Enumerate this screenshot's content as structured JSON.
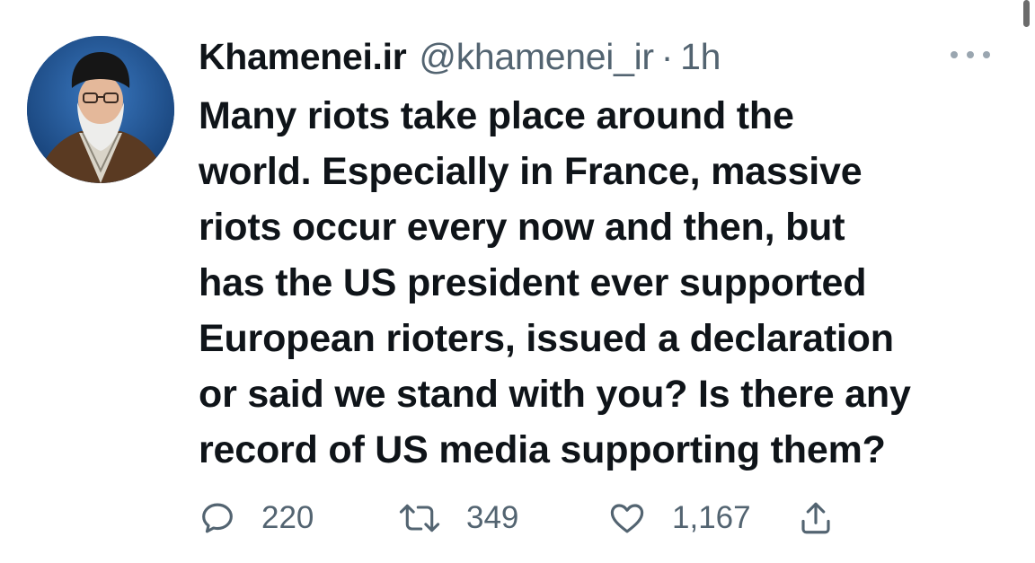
{
  "tweet": {
    "display_name": "Khamenei.ir",
    "handle": "@khamenei_ir",
    "separator": "·",
    "time": "1h",
    "text_lines": [
      "Many riots take place around the",
      "world. Especially in France, massive",
      "riots occur every now and then, but",
      "has the US president ever supported",
      "European rioters, issued a declaration",
      "or said we stand with you? Is there any",
      "record of US media supporting them?"
    ]
  },
  "actions": {
    "reply_count": "220",
    "retweet_count": "349",
    "like_count": "1,167"
  },
  "icons": {
    "more": "more-horizontal-icon",
    "reply": "reply-icon",
    "retweet": "retweet-icon",
    "like": "heart-icon",
    "share": "share-icon"
  },
  "colors": {
    "text_primary": "#0f1419",
    "text_secondary": "#536471",
    "background": "#ffffff"
  }
}
